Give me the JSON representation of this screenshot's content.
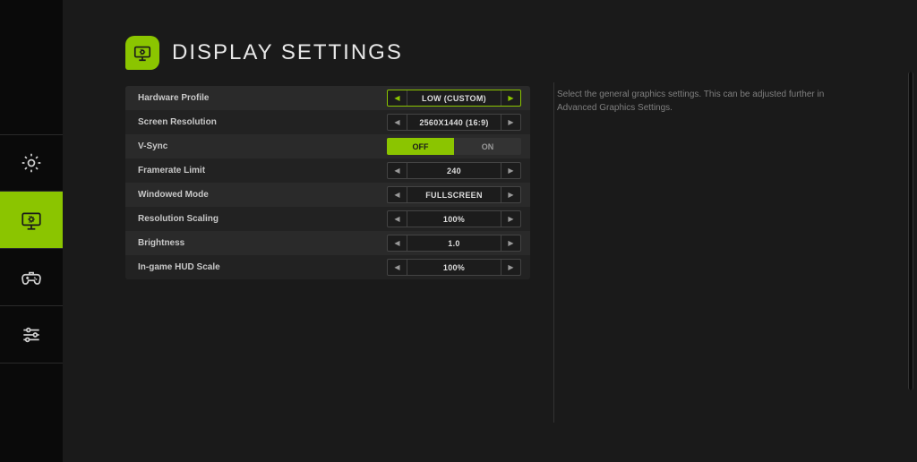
{
  "title": "DISPLAY SETTINGS",
  "help_text": "Select the general graphics settings. This can be adjusted further in Advanced Graphics Settings.",
  "rows": {
    "hardware_profile": {
      "label": "Hardware Profile",
      "value": "LOW (CUSTOM)"
    },
    "screen_resolution": {
      "label": "Screen Resolution",
      "value": "2560X1440 (16:9)"
    },
    "vsync": {
      "label": "V-Sync",
      "off": "OFF",
      "on": "ON"
    },
    "framerate_limit": {
      "label": "Framerate Limit",
      "value": "240"
    },
    "windowed_mode": {
      "label": "Windowed Mode",
      "value": "FULLSCREEN"
    },
    "resolution_scaling": {
      "label": "Resolution Scaling",
      "value": "100%"
    },
    "brightness": {
      "label": "Brightness",
      "value": "1.0"
    },
    "hud_scale": {
      "label": "In-game HUD Scale",
      "value": "100%"
    }
  },
  "sidebar": {
    "items": [
      "general",
      "display",
      "controls",
      "sliders"
    ]
  }
}
